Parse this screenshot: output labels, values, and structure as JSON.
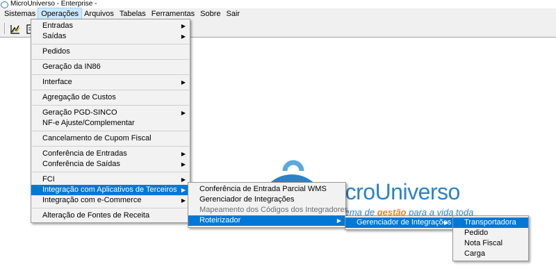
{
  "window": {
    "title": "MicroUniverso - Enterprise -"
  },
  "menubar": {
    "items": [
      {
        "label": "Sistemas"
      },
      {
        "label": "Operações"
      },
      {
        "label": "Arquivos"
      },
      {
        "label": "Tabelas"
      },
      {
        "label": "Ferramentas"
      },
      {
        "label": "Sobre"
      },
      {
        "label": "Sair"
      }
    ]
  },
  "toolbar": {
    "buttons": [
      {
        "icon": "chart-icon"
      },
      {
        "icon": "document-icon"
      }
    ]
  },
  "background_logo": {
    "text": "icroUniverso",
    "subtitle_start": "tema de ",
    "subtitle_bold": "gestão",
    "subtitle_end": " para a vida toda"
  },
  "operacoes_menu": {
    "items": [
      {
        "label": "Entradas",
        "submenu": true
      },
      {
        "label": "Saídas",
        "submenu": true
      },
      {
        "label": "Pedidos"
      },
      {
        "label": "Geração da IN86"
      },
      {
        "label": "Interface",
        "submenu": true
      },
      {
        "label": "Agregação de Custos"
      },
      {
        "label": "Geração PGD-SINCO",
        "submenu": true
      },
      {
        "label": "NF-e Ajuste/Complementar"
      },
      {
        "label": "Cancelamento de Cupom Fiscal"
      },
      {
        "label": "Conferência de Entradas",
        "submenu": true
      },
      {
        "label": "Conferência de Saídas",
        "submenu": true
      },
      {
        "label": "FCI",
        "submenu": true
      },
      {
        "label": "Integração com Aplicativos de Terceiros",
        "submenu": true
      },
      {
        "label": "Integração com e-Commerce",
        "submenu": true
      },
      {
        "label": "Alteração de Fontes de Receita"
      }
    ]
  },
  "integracao_menu": {
    "items": [
      {
        "label": "Conferência de Entrada Parcial WMS"
      },
      {
        "label": "Gerenciador de Integrações"
      },
      {
        "label": "Mapeamento dos Códigos dos Integradores"
      },
      {
        "label": "Roteirizador",
        "submenu": true
      }
    ]
  },
  "roteirizador_menu": {
    "items": [
      {
        "label": "Gerenciador de Integrações",
        "submenu": true
      }
    ]
  },
  "gerenciador_menu": {
    "items": [
      {
        "label": "Transportadora"
      },
      {
        "label": "Pedido"
      },
      {
        "label": "Nota Fiscal"
      },
      {
        "label": "Carga"
      }
    ]
  },
  "colors": {
    "highlight": "#0078d7",
    "logo": "#2a82c9",
    "menu_bg": "#f2f2f2"
  }
}
